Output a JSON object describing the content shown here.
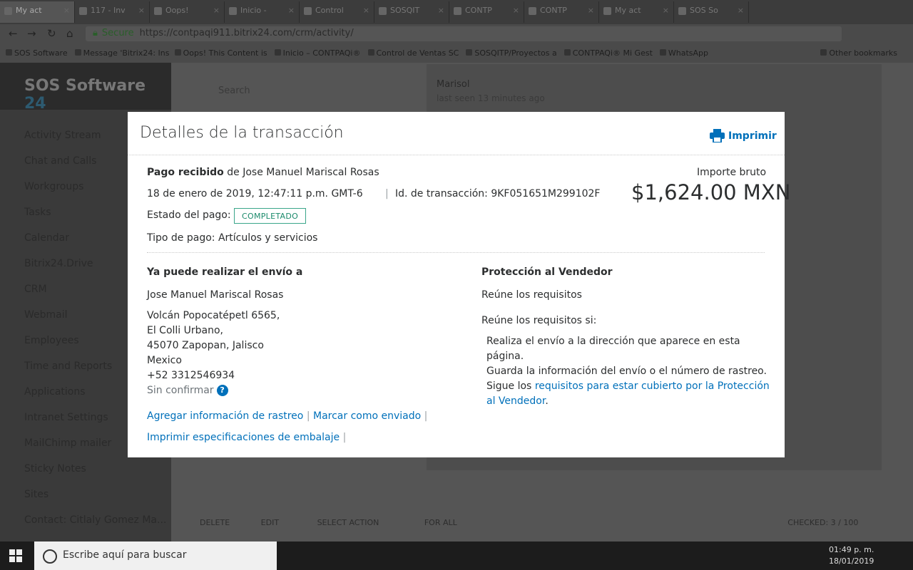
{
  "browser": {
    "tabs": [
      "My act",
      "117 - Inv",
      "Oops!",
      "Inicio -",
      "Control",
      "SOSQIT",
      "CONTP",
      "CONTP",
      "My act",
      "SOS So"
    ],
    "url_secure": "Secure",
    "url": "https://contpaqi911.bitrix24.com/crm/activity/",
    "bookmarks": [
      "SOS Software",
      "Message 'Bitrix24: Ins",
      "Oops! This Content is",
      "Inicio – CONTPAQi®",
      "Control de Ventas SC",
      "SOSQITP/Proyectos a",
      "CONTPAQi® Mi Gest",
      "WhatsApp",
      "Other bookmarks"
    ]
  },
  "app": {
    "brand": "SOS Software",
    "brand_num": "24",
    "search_placeholder": "Search",
    "menu": [
      "Activity Stream",
      "Chat and Calls",
      "Workgroups",
      "Tasks",
      "Calendar",
      "Bitrix24.Drive",
      "CRM",
      "Webmail",
      "Employees",
      "Time and Reports",
      "Applications",
      "Intranet Settings",
      "MailChimp mailer",
      "Sticky Notes",
      "Sites",
      "Contact: Citlaly Gomez Ma..."
    ],
    "chat_name": "Marisol",
    "chat_seen": "last seen 13 minutes ago",
    "bottom_actions": [
      "DELETE",
      "EDIT",
      "SELECT ACTION",
      "FOR ALL"
    ],
    "checked": "CHECKED: 3 / 100"
  },
  "modal": {
    "title": "Detalles de la transacción",
    "print_label": "Imprimir",
    "payment_received_label": "Pago recibido",
    "payment_from": " de Jose Manuel Mariscal Rosas",
    "date": "18 de enero de 2019, 12:47:11 p.m. GMT-6",
    "transaction_id_label": "Id. de transacción: ",
    "transaction_id": "9KF051651M299102F",
    "gross_label": "Importe bruto",
    "gross_amount": "$1,624.00 MXN",
    "status_label": "Estado del pago:",
    "status_value": "COMPLETADO",
    "payment_type": "Tipo de pago: Artículos y servicios",
    "ship_heading": "Ya puede realizar el envío a",
    "ship_name": "Jose Manuel Mariscal Rosas",
    "address": [
      "Volcán Popocatépetl 6565,",
      "El Colli Urbano,",
      "45070 Zapopan, Jalisco",
      "Mexico",
      "+52 3312546934"
    ],
    "unconfirmed": "Sin confirmar",
    "help_icon": "?",
    "links": {
      "add_tracking": "Agregar información de rastreo",
      "mark_shipped": "Marcar como enviado",
      "print_packing": "Imprimir especificaciones de embalaje"
    },
    "protection_heading": "Protección al Vendedor",
    "protection_status": "Reúne los requisitos",
    "protection_if": "Reúne los requisitos si:",
    "protection_lines": [
      "Realiza el envío a la dirección que aparece en esta",
      "página.",
      "Guarda la información del envío o el número de rastreo."
    ],
    "protection_follow": "Sigue los ",
    "protection_link_1": "requisitos para estar cubierto por la Protección",
    "protection_link_2": "al Vendedor",
    "protection_end": "."
  },
  "taskbar": {
    "search": "Escribe aquí para buscar",
    "time": "01:49 p. m.",
    "date": "18/01/2019"
  }
}
